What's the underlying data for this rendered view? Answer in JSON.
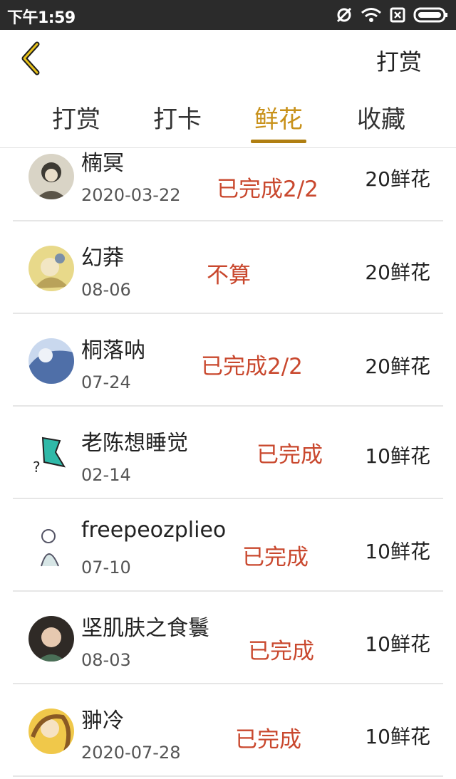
{
  "status_bar": {
    "time": "下午1:59"
  },
  "header": {
    "action_label": "打赏"
  },
  "tabs": [
    {
      "label": "打赏"
    },
    {
      "label": "打卡"
    },
    {
      "label": "鲜花"
    },
    {
      "label": "收藏"
    }
  ],
  "active_tab": "鲜花",
  "records": [
    {
      "name": "楠冥",
      "date": "2020-03-22",
      "status": "已完成2/2",
      "amount": "20鲜花"
    },
    {
      "name": "幻莽",
      "date": "08-06",
      "status": "不算",
      "amount": "20鲜花"
    },
    {
      "name": "桐落呐",
      "date": "07-24",
      "status": "已完成2/2",
      "amount": "20鲜花"
    },
    {
      "name": "老陈想睡觉",
      "date": "02-14",
      "status": "已完成",
      "amount": "10鲜花"
    },
    {
      "name": "freepeozplieo",
      "date": "07-10",
      "status": "已完成",
      "amount": "10鲜花"
    },
    {
      "name": "坚肌肤之食鬟",
      "date": "08-03",
      "status": "已完成",
      "amount": "10鲜花"
    },
    {
      "name": "翀冷",
      "date": "2020-07-28",
      "status": "已完成",
      "amount": "10鲜花"
    }
  ],
  "colors": {
    "accent": "#c8911a",
    "status_red": "#c9482e",
    "divider": "#e6e6e6"
  }
}
